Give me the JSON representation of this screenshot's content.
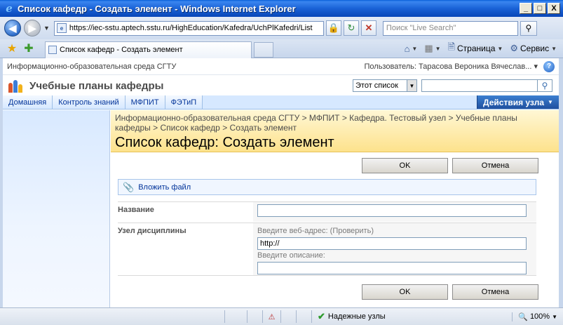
{
  "window": {
    "title": "Список кафедр - Создать элемент - Windows Internet Explorer",
    "min": "_",
    "max": "□",
    "close": "X"
  },
  "browser": {
    "url": "https://iec-sstu.aptech.sstu.ru/HighEducation/Kafedra/UchPlKafedri/List",
    "search_placeholder": "Поиск \"Live Search\"",
    "tab_title": "Список кафедр - Создать элемент",
    "cmd_home_icon": "home-icon",
    "cmd_feeds_icon": "feeds-icon",
    "cmd_page": "Страница",
    "cmd_tools": "Сервис"
  },
  "sharepoint": {
    "site_name": "Информационно-образовательная среда СГТУ",
    "user": "Пользователь: Тарасова Вероника Вячеслав...",
    "help": "?",
    "site_title": "Учебные планы кафедры",
    "search_scope": "Этот список",
    "nav_tabs": [
      "Домашняя",
      "Контроль знаний",
      "МФПИТ",
      "ФЭТиП"
    ],
    "site_actions": "Действия узла",
    "breadcrumbs": "Информационно-образовательная среда СГТУ > МФПИТ > Кафедра. Тестовый узел > Учебные планы кафедры > Список кафедр > Создать элемент",
    "page_title": "Список кафедр: Создать элемент"
  },
  "form": {
    "ok": "OK",
    "cancel": "Отмена",
    "attach": "Вложить файл",
    "field_name_label": "Название",
    "field_name_value": "",
    "field_url_label": "Узел дисциплины",
    "url_hint": "Введите веб-адрес:",
    "url_check": "(Проверить)",
    "url_value": "http://",
    "desc_hint": "Введите описание:",
    "desc_value": ""
  },
  "status": {
    "zone": "Надежные узлы",
    "zoom": "100%"
  }
}
